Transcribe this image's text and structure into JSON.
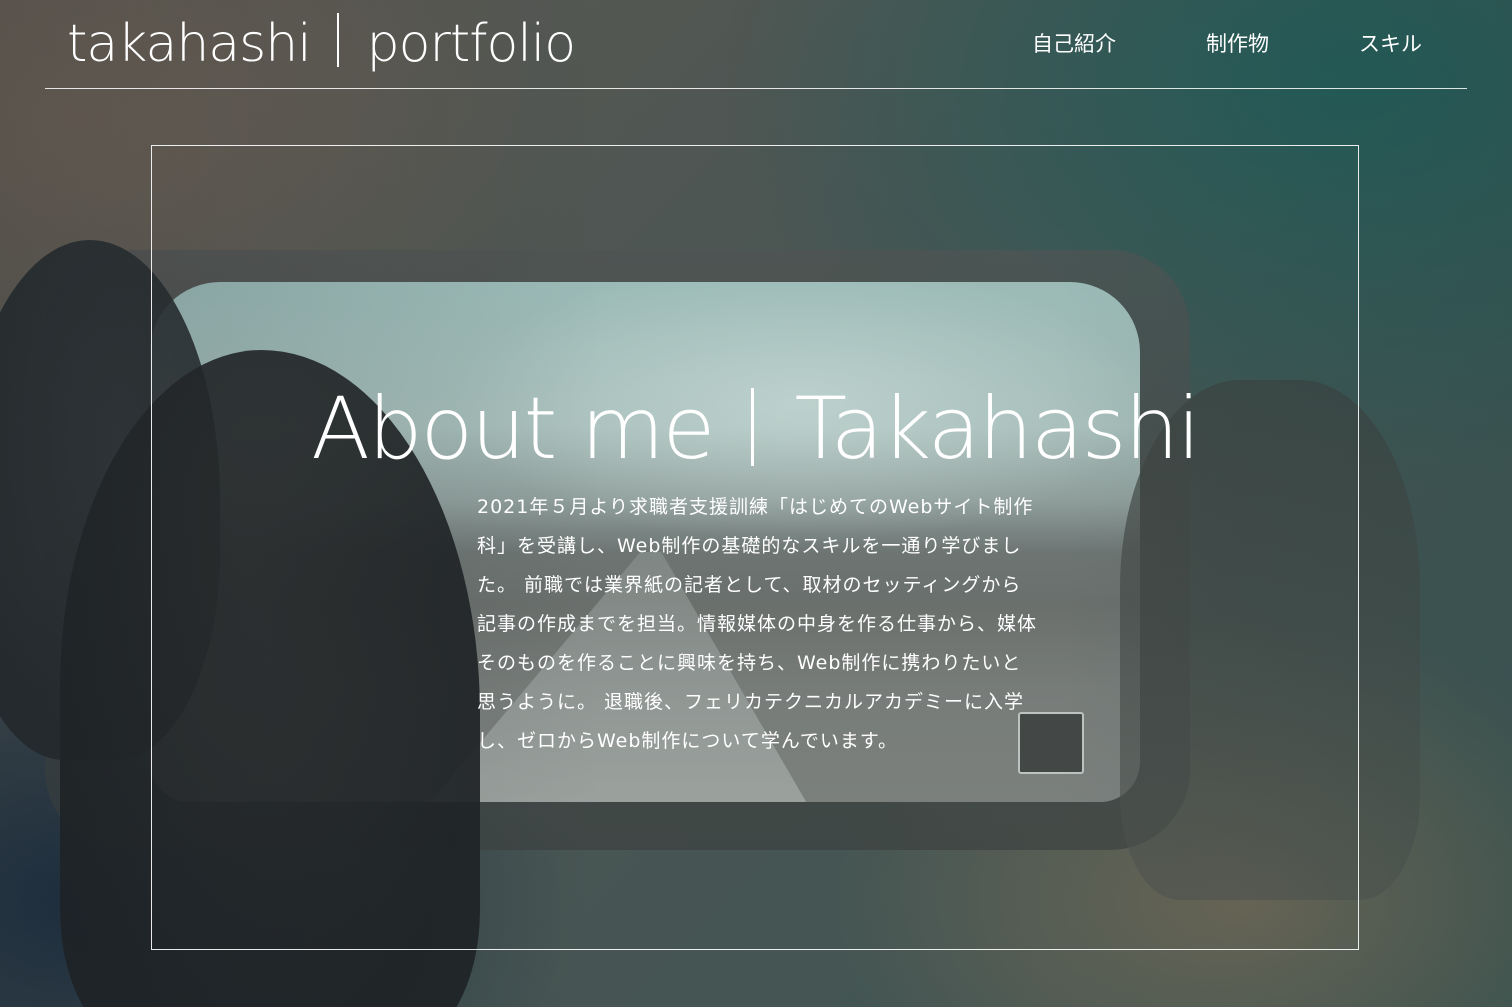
{
  "header": {
    "logo_left": "takahashi",
    "logo_right": "portfolio",
    "nav": [
      {
        "label": "自己紹介"
      },
      {
        "label": "制作物"
      },
      {
        "label": "スキル"
      }
    ]
  },
  "hero": {
    "title_left": "About me",
    "title_right": "Takahashi",
    "body": "2021年５月より求職者支援訓練「はじめてのWebサイト制作科」を受講し、Web制作の基礎的なスキルを一通り学びました。 前職では業界紙の記者として、取材のセッティングから記事の作成までを担当。情報媒体の中身を作る仕事から、媒体そのものを作ることに興味を持ち、Web制作に携わりたいと思うように。 退職後、フェリカテクニカルアカデミーに入学し、ゼロからWeb制作について学んでいます。",
    "background_image": "woman-looking-out-van-window-icon"
  },
  "colors": {
    "text": "#ffffff",
    "accent_teal": "#2f5f5c"
  }
}
